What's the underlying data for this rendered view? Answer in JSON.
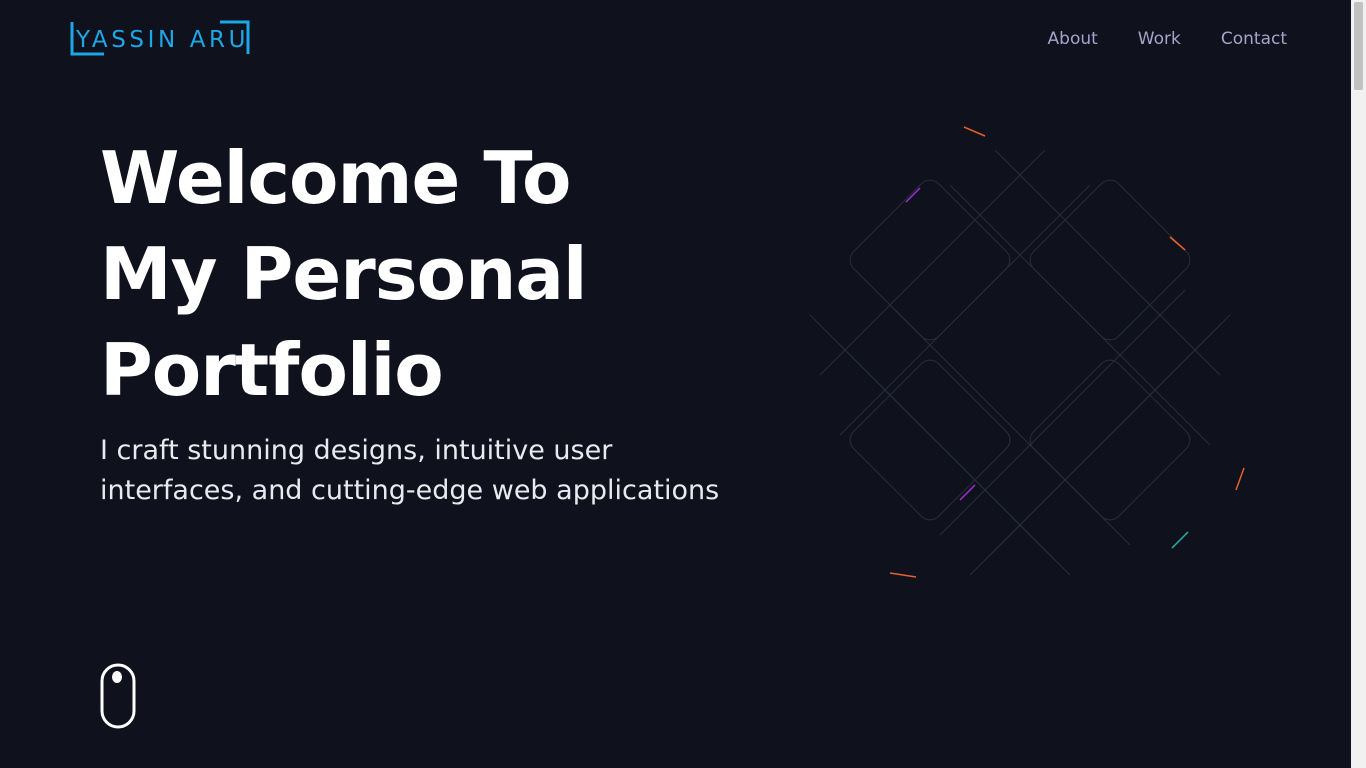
{
  "brand": {
    "logo_text": "YASSIN ARU",
    "color": "#1ea7e7"
  },
  "nav": {
    "items": [
      {
        "label": "About"
      },
      {
        "label": "Work"
      },
      {
        "label": "Contact"
      }
    ],
    "color": "#a6a2ca"
  },
  "hero": {
    "title_lines": [
      "Welcome To",
      "My Personal",
      "Portfolio"
    ],
    "subtitle_lines": [
      "I craft stunning designs, intuitive user",
      "interfaces, and cutting-edge web applications"
    ]
  },
  "icons": {
    "scroll": "mouse-scroll-icon",
    "graphic": "diamond-grid-graphic"
  },
  "colors": {
    "background": "#0f111d",
    "title": "#ffffff",
    "subtitle": "#e9e9ef",
    "accent_orange": "#e2622a",
    "accent_purple": "#9b32d6",
    "accent_teal": "#1fb3b3"
  }
}
